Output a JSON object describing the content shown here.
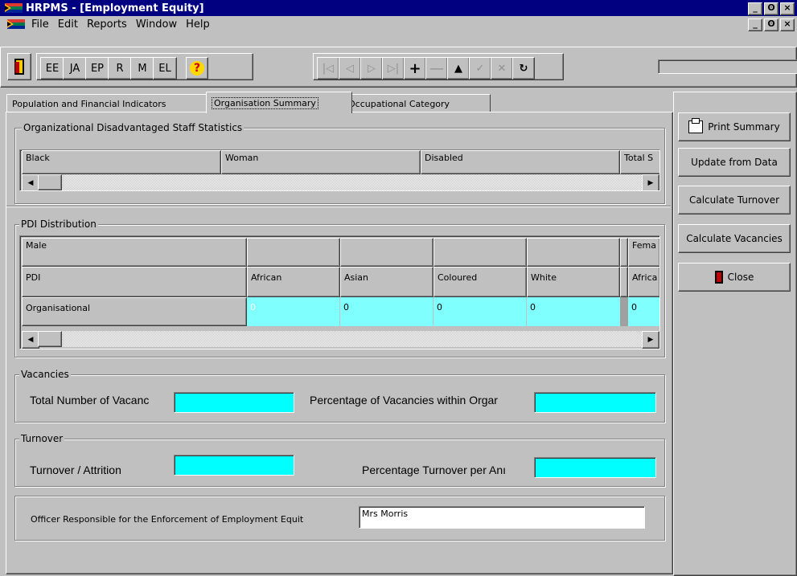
{
  "window": {
    "title": "HRPMS - [Employment Equity]",
    "controls": [
      "_",
      "ā",
      "×"
    ]
  },
  "menu": {
    "items": [
      "File",
      "Edit",
      "Reports",
      "Window",
      "Help"
    ]
  },
  "toolbar": {
    "buttons": [
      "EE",
      "JA",
      "EP",
      "R",
      "M",
      "EL"
    ],
    "help": "?",
    "nav": [
      "first-icon",
      "prev-icon",
      "next-icon",
      "last-icon",
      "add-icon",
      "delete-icon",
      "up-icon",
      "check-icon",
      "cancel-icon",
      "refresh-icon"
    ]
  },
  "tabs": [
    "Population and Financial Indicators",
    "Organisation Summary",
    "Occupational Category"
  ],
  "disadvantaged": {
    "title": "Organizational Disadvantaged Staff Statistics",
    "columns": [
      "Black",
      "Woman",
      "Disabled",
      "Total S"
    ]
  },
  "pdi": {
    "title": "PDI Distribution",
    "row1": [
      "Male",
      "",
      "",
      "",
      "",
      "Fema"
    ],
    "row2": [
      "PDI",
      "African",
      "Asian",
      "Coloured",
      "White",
      "Africa"
    ],
    "row3": [
      "Organisational",
      "0",
      "0",
      "0",
      "0",
      "0"
    ]
  },
  "vacancies": {
    "title": "Vacancies",
    "total_label": "Total Number of Vacanc",
    "pct_label": "Percentage of Vacancies within Orgar",
    "total_value": "",
    "pct_value": ""
  },
  "turnover": {
    "title": "Turnover",
    "attrition_label": "Turnover / Attrition",
    "pct_label": "Percentage Turnover per Anı",
    "attrition_value": "",
    "pct_value": ""
  },
  "officer": {
    "label": "Officer Responsible for the Enforcement of Employment Equit",
    "value": "Mrs Morris"
  },
  "actions": {
    "print": "Print Summary",
    "update": "Update from Data",
    "calc_turnover": "Calculate Turnover",
    "calc_vacancies": "Calculate Vacancies",
    "close": "Close"
  },
  "colors": {
    "title_bar": "#000080",
    "field": "#00ffff",
    "grid_cell": "#80ffff"
  }
}
